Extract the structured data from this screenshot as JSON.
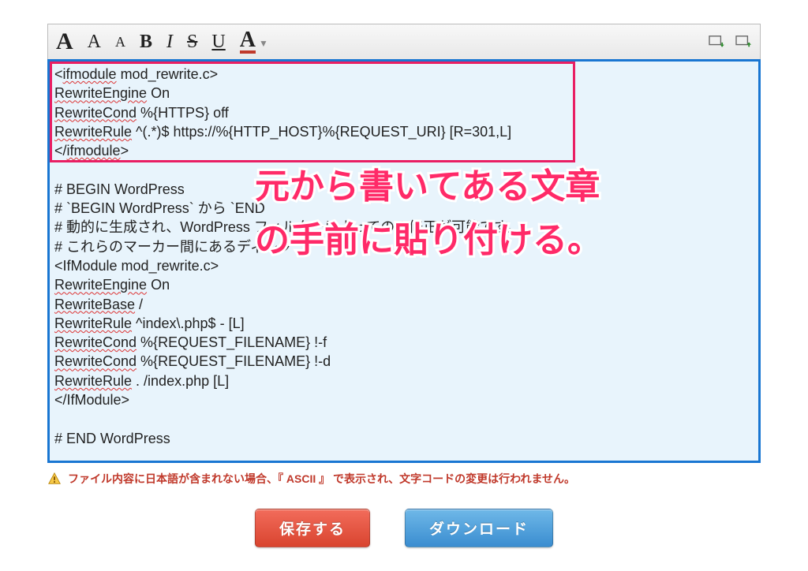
{
  "toolbar": {
    "font_big": "A",
    "font_med": "A",
    "font_small": "A",
    "bold": "B",
    "italic": "I",
    "strike": "S",
    "underline": "U",
    "color": "A"
  },
  "editor": {
    "block1": {
      "l1_a": "<",
      "l1_b": "ifmodule",
      "l1_c": " mod_rewrite.c>",
      "l2_a": "RewriteEngine",
      "l2_b": " On",
      "l3_a": "RewriteCond",
      "l3_b": " %{HTTPS} off",
      "l4_a": "RewriteRule",
      "l4_b": " ^(.*)$ https://%{HTTP_HOST}%{REQUEST_URI} [R=301,L]",
      "l5_a": "</",
      "l5_b": "ifmodule",
      "l5_c": ">"
    },
    "block2": {
      "l1": "# BEGIN WordPress",
      "l2": "# `BEGIN WordPress` から `END ",
      "l3": "# 動的に生成され、WordPress フィルターによってのみ修正が可能です。",
      "l4": "# これらのマーカー間にあるディレク",
      "l5": "<IfModule mod_rewrite.c>",
      "l6_a": "RewriteEngine",
      "l6_b": " On",
      "l7_a": "RewriteBase",
      "l7_b": " /",
      "l8_a": "RewriteRule",
      "l8_b": " ^index\\.php$ - [L]",
      "l9_a": "RewriteCond",
      "l9_b": " %{REQUEST_FILENAME} !-f",
      "l10_a": "RewriteCond",
      "l10_b": " %{REQUEST_FILENAME} !-d",
      "l11_a": "RewriteRule",
      "l11_b": " . /index.php [L]",
      "l12": "</IfModule>",
      "l13": "",
      "l14": "# END WordPress"
    }
  },
  "annotation": {
    "line1": "元から書いてある文章",
    "line2": "の手前に貼り付ける。"
  },
  "warning": "ファイル内容に日本語が含まれない場合、『 ASCII 』 で表示され、文字コードの変更は行われません。",
  "buttons": {
    "save": "保存する",
    "download": "ダウンロード"
  }
}
